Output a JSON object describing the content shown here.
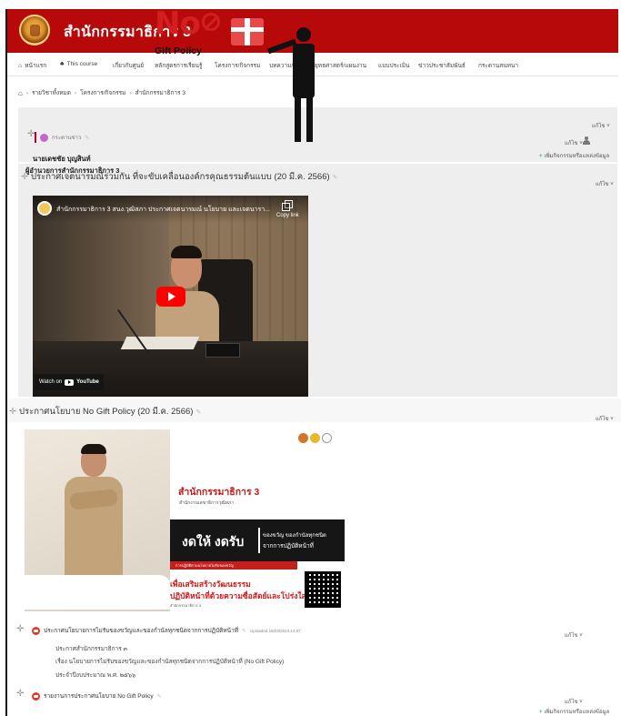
{
  "header": {
    "site_title": "สำนักกรรมาธิการ 3"
  },
  "nav": {
    "items": [
      "หน้าแรก",
      "This course",
      "เกี่ยวกับศูนย์",
      "หลักสูตรการเรียนรู้",
      "โครงการ/กิจกรรม",
      "บทความ/วิจัย",
      "ยุทธศาสตร์/แผนงาน",
      "แบบประเมิน",
      "ข่าวประชาสัมพันธ์",
      "กระดานสนทนา"
    ]
  },
  "breadcrumb": [
    "รายวิชาทั้งหมด",
    "โครงการ/กิจกรรม",
    "สำนักกรรมาธิการ 3"
  ],
  "labels": {
    "edit": "แก้ไข",
    "add_activity": "เพิ่มกิจกรรมหรือแหล่งข้อมูล",
    "move": "✛",
    "pencil": "✎"
  },
  "section0": {
    "forum_label": " กระดานข่าว"
  },
  "section1": {
    "title": "ประกาศเจตนารมณ์ร่วมกัน ที่จะขับเคลื่อนองค์กรคุณธรรมต้นแบบ (20 มี.ค. 2566)",
    "video": {
      "title": "สำนักกรรมาธิการ 3 สนง.วุฒิสภา ประกาศเจตนารมณ์ นโยบาย และเจตนารา...",
      "copy_link": "Copy link",
      "watch_on": "Watch on",
      "brand": "YouTube"
    }
  },
  "section2": {
    "title": "ประกาศนโยบาย No Gift Policy (20 มี.ค. 2566)",
    "poster": {
      "no": "No",
      "gift_policy": "Gift Policy",
      "office": "สำนักกรรมาธิการ 3",
      "sub": "สำนักงานเลขาธิการวุฒิสภา",
      "give_receive": "งดให้ งดรับ",
      "give_line1": "ของขวัญ ของกำนัลทุกชนิด",
      "give_line2": "จากการปฏิบัติหน้าที่",
      "tiny": "การปฏิบัติตามนโยบายไม่รับของขวัญ",
      "slogan1": "เพื่อเสริมสร้างวัฒนธรรม",
      "slogan2": "ปฏิบัติหน้าที่ด้วยความซื่อสัตย์และโปร่งใส",
      "footer": "สำนักกรรมาธิการ 3",
      "person_name": "นายเดชชัย บุญสินท์",
      "person_role": "ผู้อำนวยการสำนักกรรมาธิการ 3"
    },
    "activity1": {
      "name": "ประกาศนโยบายการไม่รับของขวัญและของกำนัลทุกชนิดจากการปฏิบัติหน้าที่",
      "meta": "Uploaded 16/03/2023 13:37",
      "desc_lines": [
        "ประกาศสำนักกรรมาธิการ ๓",
        "เรื่อง นโยบายการไม่รับของขวัญและของกำนัลทุกชนิดจากการปฏิบัติหน้าที่ (No Gift Policy)",
        "ประจำปีงบประมาณ พ.ศ. ๒๕๖๖"
      ]
    },
    "activity2": {
      "name": "รายงานการประกาศนโยบาย No Gift Policy"
    }
  },
  "colors": {
    "header_bg": "#b7090a",
    "section_bg": "#eeeeee",
    "accent_red": "#d21f1f"
  }
}
